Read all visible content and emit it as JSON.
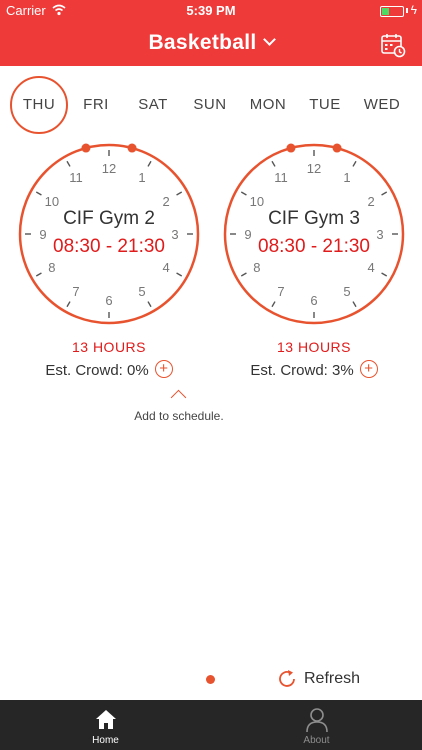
{
  "status_bar": {
    "carrier": "Carrier",
    "time": "5:39 PM"
  },
  "nav": {
    "title": "Basketball"
  },
  "days": [
    {
      "label": "THU",
      "selected": true
    },
    {
      "label": "FRI",
      "selected": false
    },
    {
      "label": "SAT",
      "selected": false
    },
    {
      "label": "SUN",
      "selected": false
    },
    {
      "label": "MON",
      "selected": false
    },
    {
      "label": "TUE",
      "selected": false
    },
    {
      "label": "WED",
      "selected": false
    }
  ],
  "gyms": [
    {
      "name": "CIF Gym 2",
      "time": "08:30 - 21:30",
      "hours": "13 HOURS",
      "crowd": "Est. Crowd: 0%",
      "plus": "+"
    },
    {
      "name": "CIF Gym 3",
      "time": "08:30 - 21:30",
      "hours": "13 HOURS",
      "crowd": "Est. Crowd: 3%",
      "plus": "+"
    }
  ],
  "clock_numbers": [
    "12",
    "1",
    "2",
    "3",
    "4",
    "5",
    "6",
    "7",
    "8",
    "9",
    "10",
    "11"
  ],
  "add_schedule": "Add to schedule.",
  "refresh_label": "Refresh",
  "tabs": [
    {
      "label": "Home",
      "active": true
    },
    {
      "label": "About",
      "active": false
    }
  ],
  "colors": {
    "brand_red": "#ef3a3a",
    "accent_orange": "#e8532f",
    "time_red": "#e01b1b",
    "tab_bar": "#262626"
  }
}
